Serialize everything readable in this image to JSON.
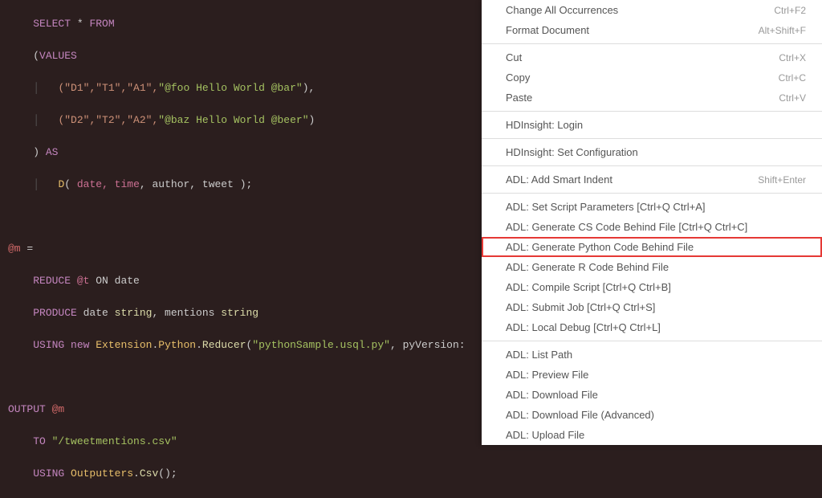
{
  "code": {
    "line1_kw1": "SELECT",
    "line1_star": " * ",
    "line1_kw2": "FROM",
    "line2_paren": "(",
    "line2_kw": "VALUES",
    "line3_tuple": "(\"D1\",\"T1\",\"A1\",",
    "line3_str": "\"@foo Hello World @bar\"",
    "line3_end": "),",
    "line4_tuple": "(\"D2\",\"T2\",\"A2\",",
    "line4_str": "\"@baz Hello World @beer\"",
    "line4_end": ")",
    "line5_paren": ") ",
    "line5_kw": "AS",
    "line6_d": "D",
    "line6_paren": "( ",
    "line6_date": "date",
    "line6_time": ", time",
    "line6_rest": ", author, tweet );",
    "line8_at": "@m",
    "line8_eq": " =",
    "line9_kw": "REDUCE ",
    "line9_var": "@t",
    "line9_rest": " ON date",
    "line10_kw1": "PRODUCE",
    "line10_date": " date ",
    "line10_str1": "string",
    "line10_mentions": ", mentions ",
    "line10_str2": "string",
    "line11_kw1": "USING ",
    "line11_kw2": "new ",
    "line11_ext": "Extension",
    "line11_dot1": ".",
    "line11_py": "Python",
    "line11_dot2": ".",
    "line11_red": "Reducer",
    "line11_paren": "(",
    "line11_arg1": "\"pythonSample.usql.py\"",
    "line11_comma": ", pyVersion:",
    "line13_kw": "OUTPUT ",
    "line13_var": "@m",
    "line14_kw": "TO ",
    "line14_str": "\"/tweetmentions.csv\"",
    "line15_kw": "USING ",
    "line15_out": "Outputters",
    "line15_dot": ".",
    "line15_csv": "Csv",
    "line15_end": "();"
  },
  "menu": {
    "groups": [
      [
        {
          "label": "Change All Occurrences",
          "shortcut": "Ctrl+F2"
        },
        {
          "label": "Format Document",
          "shortcut": "Alt+Shift+F"
        }
      ],
      [
        {
          "label": "Cut",
          "shortcut": "Ctrl+X"
        },
        {
          "label": "Copy",
          "shortcut": "Ctrl+C"
        },
        {
          "label": "Paste",
          "shortcut": "Ctrl+V"
        }
      ],
      [
        {
          "label": "HDInsight: Login",
          "shortcut": ""
        }
      ],
      [
        {
          "label": "HDInsight: Set Configuration",
          "shortcut": ""
        }
      ],
      [
        {
          "label": "ADL: Add Smart Indent",
          "shortcut": "Shift+Enter"
        }
      ],
      [
        {
          "label": "ADL: Set Script Parameters [Ctrl+Q Ctrl+A]",
          "shortcut": ""
        },
        {
          "label": "ADL: Generate CS Code Behind File [Ctrl+Q Ctrl+C]",
          "shortcut": ""
        },
        {
          "label": "ADL: Generate Python Code Behind File",
          "shortcut": "",
          "highlighted": true
        },
        {
          "label": "ADL: Generate R Code Behind File",
          "shortcut": ""
        },
        {
          "label": "ADL: Compile Script [Ctrl+Q Ctrl+B]",
          "shortcut": ""
        },
        {
          "label": "ADL: Submit Job [Ctrl+Q Ctrl+S]",
          "shortcut": ""
        },
        {
          "label": "ADL: Local Debug [Ctrl+Q Ctrl+L]",
          "shortcut": ""
        }
      ],
      [
        {
          "label": "ADL: List Path",
          "shortcut": ""
        },
        {
          "label": "ADL: Preview File",
          "shortcut": ""
        },
        {
          "label": "ADL: Download File",
          "shortcut": ""
        },
        {
          "label": "ADL: Download File (Advanced)",
          "shortcut": ""
        },
        {
          "label": "ADL: Upload File",
          "shortcut": ""
        }
      ]
    ]
  }
}
